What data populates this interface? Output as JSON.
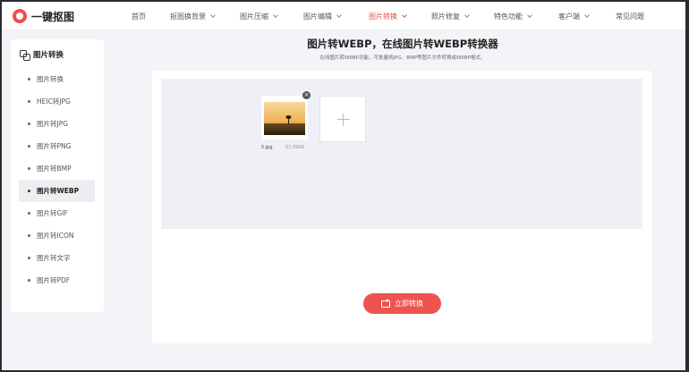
{
  "brand": {
    "name": "一键抠图",
    "logo_icon": "logo-ring-icon",
    "accent": "#ef5350"
  },
  "nav": [
    {
      "label": "首页",
      "has_chevron": false,
      "active": false
    },
    {
      "label": "抠图换背景",
      "has_chevron": true,
      "active": false
    },
    {
      "label": "图片压缩",
      "has_chevron": true,
      "active": false
    },
    {
      "label": "图片编辑",
      "has_chevron": true,
      "active": false
    },
    {
      "label": "图片转换",
      "has_chevron": true,
      "active": true
    },
    {
      "label": "照片修复",
      "has_chevron": true,
      "active": false
    },
    {
      "label": "特色功能",
      "has_chevron": true,
      "active": false
    },
    {
      "label": "客户端",
      "has_chevron": true,
      "active": false
    },
    {
      "label": "常见问题",
      "has_chevron": false,
      "active": false
    }
  ],
  "sidebar": {
    "title": "图片转换",
    "title_icon": "convert-icon",
    "items": [
      {
        "label": "图片转换",
        "active": false
      },
      {
        "label": "HEIC转JPG",
        "active": false
      },
      {
        "label": "图片转JPG",
        "active": false
      },
      {
        "label": "图片转PNG",
        "active": false
      },
      {
        "label": "图片转BMP",
        "active": false
      },
      {
        "label": "图片转WEBP",
        "active": true
      },
      {
        "label": "图片转GIF",
        "active": false
      },
      {
        "label": "图片转ICON",
        "active": false
      },
      {
        "label": "图片转文字",
        "active": false
      },
      {
        "label": "图片转PDF",
        "active": false
      }
    ]
  },
  "main": {
    "title": "图片转WEBP，在线图片转WEBP转换器",
    "subtitle": "在线图片转WEBP功能，可批量将JPG、BMP等图片文件转换成WEBP格式。",
    "file": {
      "name": "5.jpg",
      "size": "63.09KB",
      "remove_symbol": "×"
    },
    "add_symbol": "+",
    "convert_label": "立即转换"
  }
}
